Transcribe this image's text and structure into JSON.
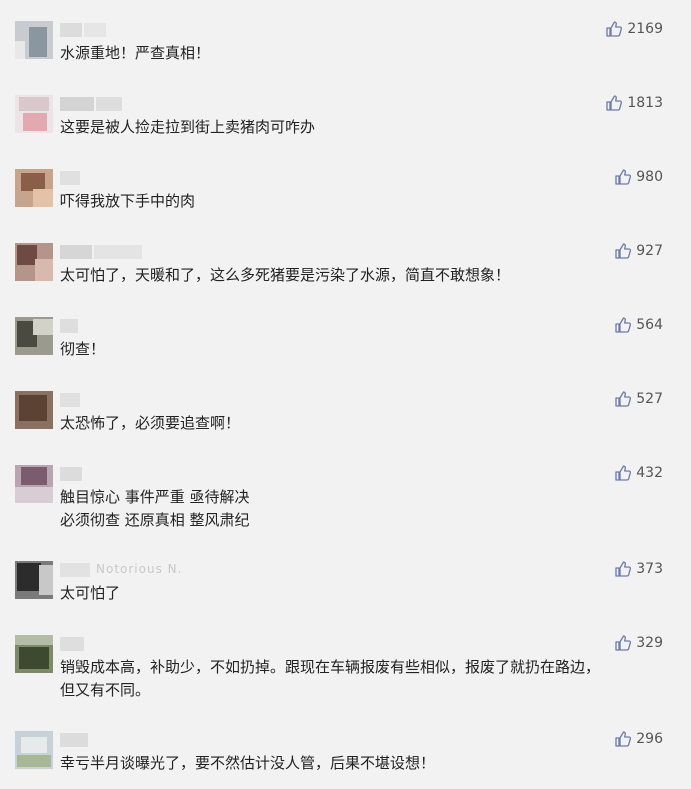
{
  "comments": [
    {
      "text": "水源重地！严查真相！",
      "likes": "2169"
    },
    {
      "text": "这要是被人捡走拉到街上卖猪肉可咋办",
      "likes": "1813"
    },
    {
      "text": "吓得我放下手中的肉",
      "likes": "980"
    },
    {
      "text": "太可怕了，天暖和了，这么多死猪要是污染了水源，简直不敢想象！",
      "likes": "927"
    },
    {
      "text": "彻查！",
      "likes": "564"
    },
    {
      "text": "太恐怖了，必须要追查啊！",
      "likes": "527"
    },
    {
      "text": "触目惊心  事件严重  亟待解决\n必须彻查  还原真相  整风肃纪",
      "likes": "432"
    },
    {
      "text": "太可怕了",
      "likes": "373",
      "name_fragment": "Notorious N."
    },
    {
      "text": "销毁成本高，补助少，不如扔掉。跟现在车辆报废有些相似，报废了就扔在路边，\n但又有不同。",
      "likes": "329"
    },
    {
      "text": "幸亏半月谈曝光了，要不然估计没人管，后果不堪设想！",
      "likes": "296"
    }
  ],
  "icons": {
    "like": "thumbs-up-icon"
  },
  "colors": {
    "background": "#f2f2f2",
    "text": "#222222",
    "likes": "#555555",
    "icon": "#6b7ba6"
  }
}
